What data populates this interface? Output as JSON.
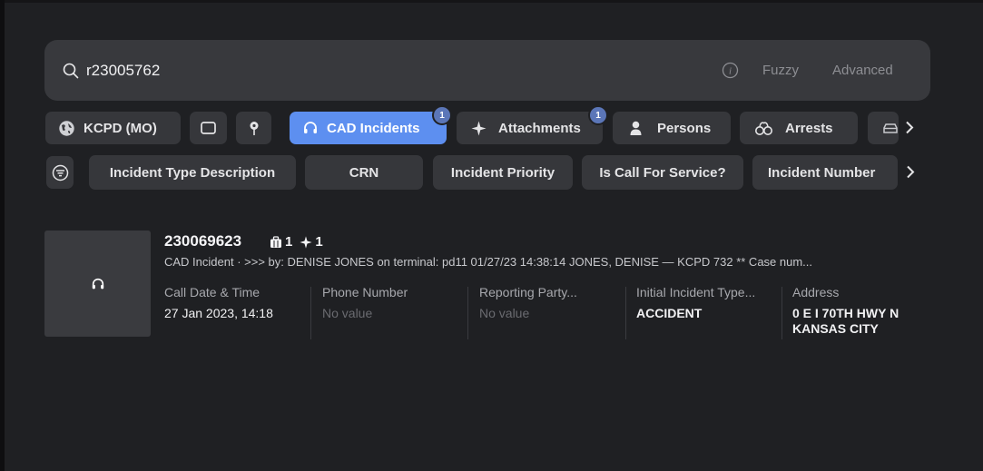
{
  "search": {
    "query": "r23005762",
    "fuzzy_label": "Fuzzy",
    "advanced_label": "Advanced"
  },
  "sources": {
    "agency_label": "KCPD (MO)",
    "cad_label": "CAD Incidents",
    "cad_badge": "1",
    "attachments_label": "Attachments",
    "attachments_badge": "1",
    "persons_label": "Persons",
    "arrests_label": "Arrests"
  },
  "filters": [
    "Incident Type Description",
    "CRN",
    "Incident Priority",
    "Is Call For Service?",
    "Incident Number"
  ],
  "result": {
    "title": "230069623",
    "attachments_count": "1",
    "links_count": "1",
    "description": "CAD Incident · >>> by: DENISE JONES on terminal: pd11 01/27/23 14:38:14 JONES, DENISE — KCPD 732 ** Case num...",
    "columns": [
      {
        "label": "Call Date & Time",
        "value": "27 Jan 2023, 14:18"
      },
      {
        "label": "Phone Number",
        "value": "No value"
      },
      {
        "label": "Reporting Party...",
        "value": "No value"
      },
      {
        "label": "Initial Incident Type...",
        "value": "ACCIDENT"
      },
      {
        "label": "Address",
        "value": "0 E I 70TH HWY N KANSAS CITY"
      }
    ]
  },
  "icons": {
    "search": "search-icon",
    "info": "info-icon",
    "agency": "globe-icon",
    "card": "card-icon",
    "pin": "map-pin-icon",
    "cad": "headset-icon",
    "attachments": "sparkle-icon",
    "persons": "person-icon",
    "arrests": "handcuffs-icon",
    "vehicles": "car-icon",
    "filter": "filter-icon"
  },
  "colors": {
    "background": "#1f2023",
    "active_chip": "#5d8ff0",
    "chip": "#36373b",
    "badge": "#5b76b8"
  }
}
